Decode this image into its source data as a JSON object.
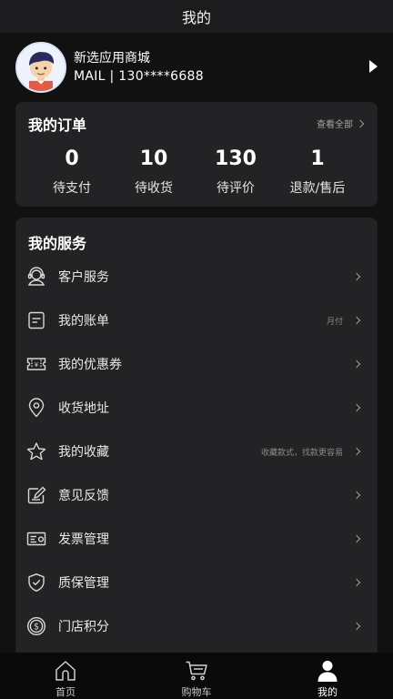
{
  "header": {
    "title": "我的"
  },
  "profile": {
    "name": "新选应用商城",
    "account": "MAIL | 130****6688"
  },
  "orders": {
    "title": "我的订单",
    "view_all": "查看全部",
    "stats": [
      {
        "value": "0",
        "label": "待支付"
      },
      {
        "value": "10",
        "label": "待收货"
      },
      {
        "value": "130",
        "label": "待评价"
      },
      {
        "value": "1",
        "label": "退款/售后"
      }
    ]
  },
  "services": {
    "title": "我的服务",
    "items": [
      {
        "label": "客户服务",
        "hint": "",
        "icon": "headset-icon"
      },
      {
        "label": "我的账单",
        "hint": "月付",
        "icon": "bill-icon"
      },
      {
        "label": "我的优惠券",
        "hint": "",
        "icon": "coupon-icon"
      },
      {
        "label": "收货地址",
        "hint": "",
        "icon": "location-icon"
      },
      {
        "label": "我的收藏",
        "hint": "收藏款式，找款更容易",
        "icon": "star-icon"
      },
      {
        "label": "意见反馈",
        "hint": "",
        "icon": "feedback-icon"
      },
      {
        "label": "发票管理",
        "hint": "",
        "icon": "invoice-icon"
      },
      {
        "label": "质保管理",
        "hint": "",
        "icon": "shield-icon"
      },
      {
        "label": "门店积分",
        "hint": "",
        "icon": "coin-icon"
      }
    ]
  },
  "tabbar": {
    "items": [
      {
        "label": "首页",
        "icon": "home-icon"
      },
      {
        "label": "购物车",
        "icon": "cart-icon"
      },
      {
        "label": "我的",
        "icon": "user-icon",
        "active": true
      }
    ]
  },
  "colors": {
    "background": "#111111",
    "card": "#232325",
    "text": "#ffffff",
    "muted": "#8a8a8a"
  }
}
